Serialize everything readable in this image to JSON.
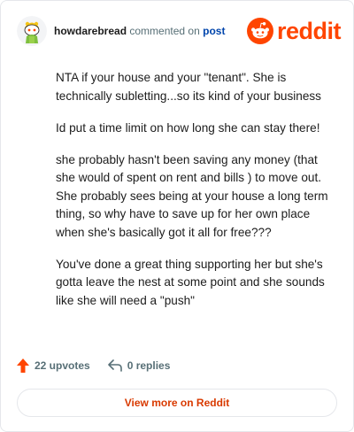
{
  "header": {
    "username": "howdarebread",
    "commented_text": "commented on",
    "post_link": "post",
    "logo_text": "reddit"
  },
  "comment": {
    "paragraphs": [
      "NTA if your house and your \"tenant\". She is technically subletting...so its kind of your business",
      "Id put a time limit on how long she can stay there!",
      "she probably hasn't been saving any money (that she would of spent on rent and bills ) to move out. She probably sees being at your house a long term thing, so why have to save up for her own place when she's basically got it all for free???",
      "You've done a great thing supporting her but she's gotta leave the nest at some point and she sounds like she will need a \"push\""
    ]
  },
  "actions": {
    "upvotes": "22 upvotes",
    "replies": "0 replies"
  },
  "view_more": "View more on Reddit",
  "colors": {
    "brand": "#ff4500",
    "link": "#0045ac",
    "muted": "#576f76",
    "cta": "#d93a00"
  },
  "icons": [
    "snoo-avatar-icon",
    "reddit-logo-icon",
    "upvote-arrow-icon",
    "reply-arrow-icon"
  ]
}
